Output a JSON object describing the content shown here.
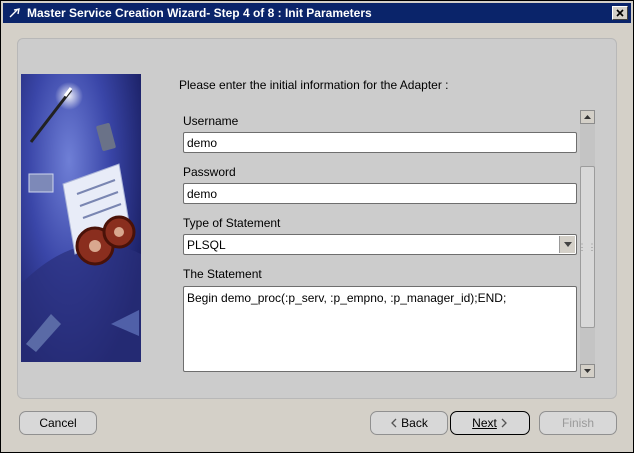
{
  "window": {
    "title": "Master Service Creation Wizard- Step 4 of 8 : Init Parameters",
    "app_icon": "oracle-icon",
    "close_icon": "close-icon"
  },
  "intro": "Please enter the initial information for the Adapter :",
  "form": {
    "username_label": "Username",
    "username_value": "demo",
    "password_label": "Password",
    "password_value": "demo",
    "statement_type_label": "Type of Statement",
    "statement_type_value": "PLSQL",
    "statement_label": "The Statement",
    "statement_value": "Begin demo_proc(:p_serv, :p_empno, :p_manager_id);END;"
  },
  "buttons": {
    "cancel": "Cancel",
    "back": "Back",
    "next": "Next",
    "finish": "Finish"
  }
}
